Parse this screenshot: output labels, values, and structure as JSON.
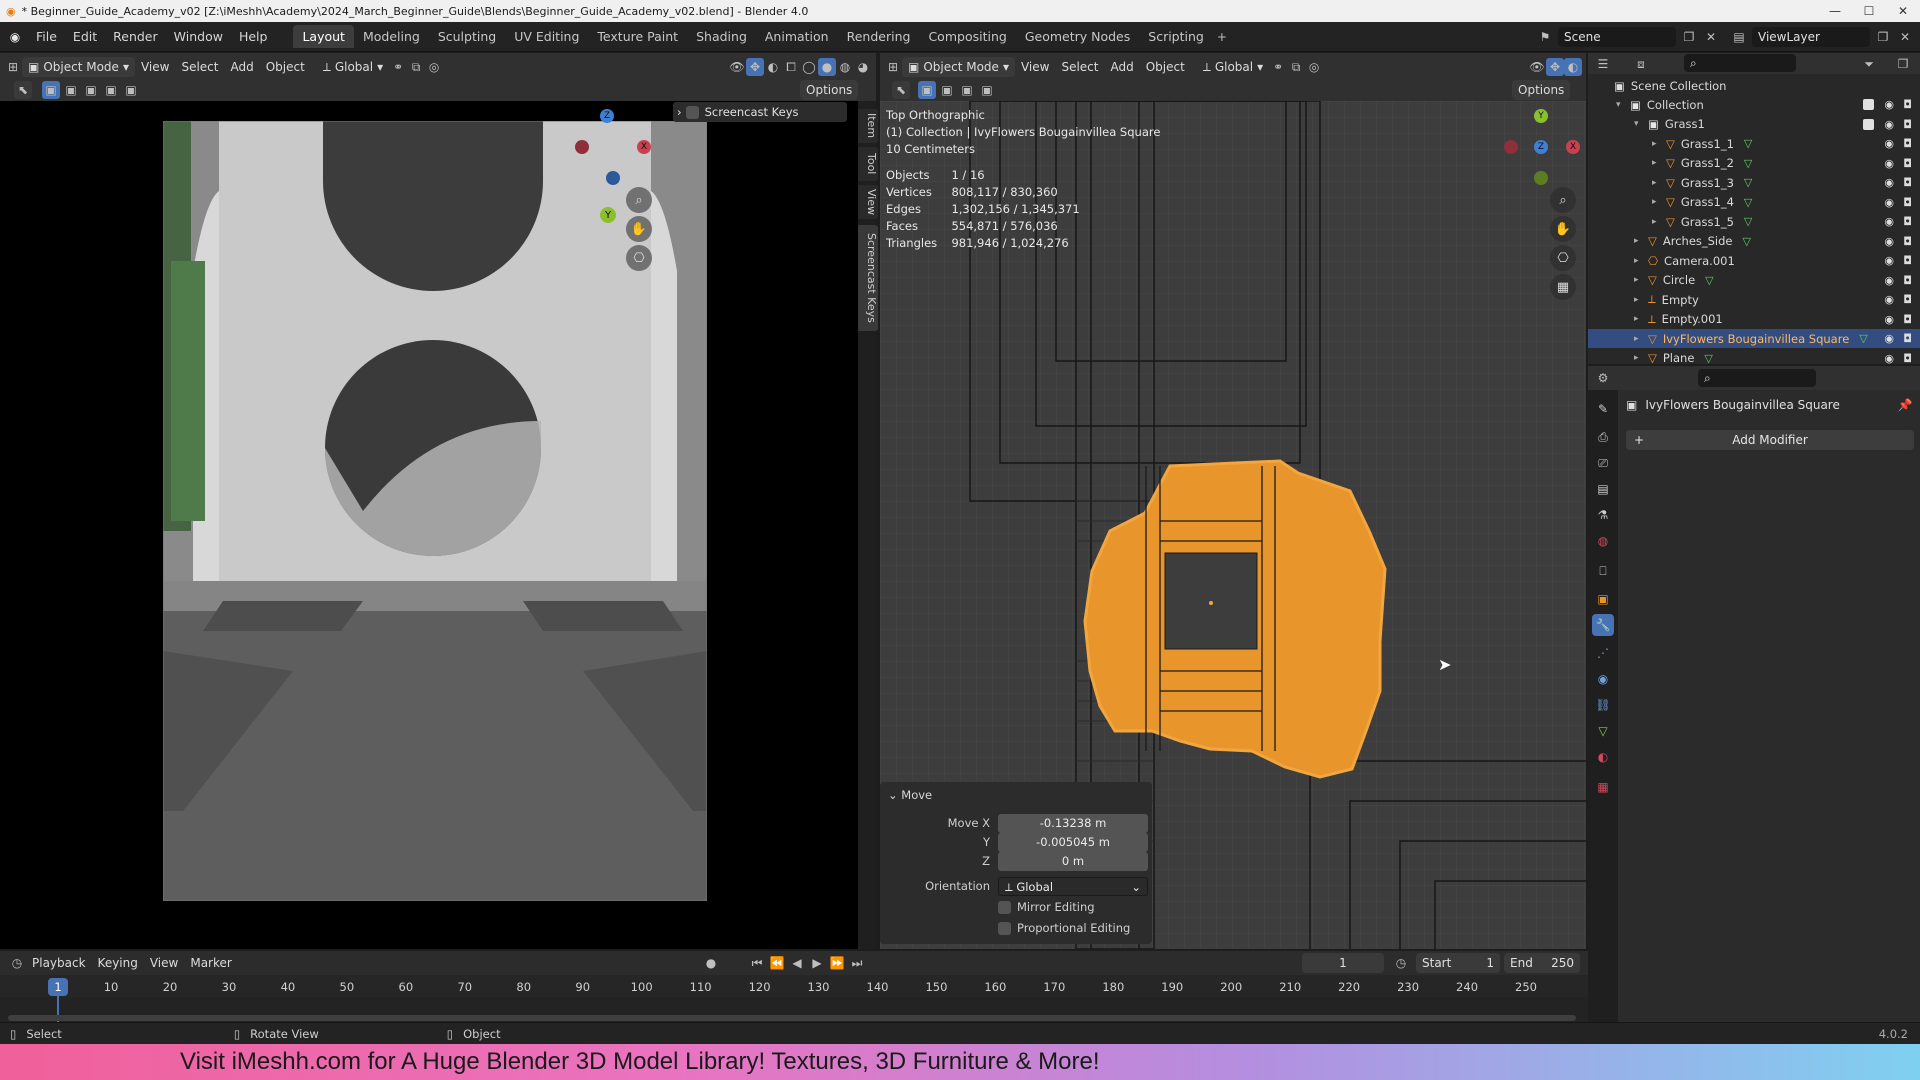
{
  "window": {
    "title": "* Beginner_Guide_Academy_v02 [Z:\\iMeshh\\Academy\\2024_March_Beginner_Guide\\Blends\\Beginner_Guide_Academy_v02.blend] - Blender 4.0"
  },
  "menus": [
    "File",
    "Edit",
    "Render",
    "Window",
    "Help"
  ],
  "workspaces": [
    "Layout",
    "Modeling",
    "Sculpting",
    "UV Editing",
    "Texture Paint",
    "Shading",
    "Animation",
    "Rendering",
    "Compositing",
    "Geometry Nodes",
    "Scripting"
  ],
  "active_workspace": "Layout",
  "scene": {
    "name": "Scene",
    "view_layer": "ViewLayer"
  },
  "left_viewport": {
    "mode": "Object Mode",
    "menus": [
      "View",
      "Select",
      "Add",
      "Object"
    ],
    "orientation": "Global",
    "options_label": "Options",
    "screencast_label": "Screencast Keys"
  },
  "sidebar_tabs": [
    "Item",
    "Tool",
    "View",
    "Screencast Keys"
  ],
  "right_viewport": {
    "mode": "Object Mode",
    "menus": [
      "View",
      "Select",
      "Add",
      "Object"
    ],
    "orientation": "Global",
    "options_label": "Options",
    "view_name": "Top Orthographic",
    "collection_line": "(1) Collection | IvyFlowers Bougainvillea Square",
    "scale": "10 Centimeters",
    "stats": [
      {
        "label": "Objects",
        "value": "1 / 16"
      },
      {
        "label": "Vertices",
        "value": "808,117 / 830,360"
      },
      {
        "label": "Edges",
        "value": "1,302,156 / 1,345,371"
      },
      {
        "label": "Faces",
        "value": "554,871 / 576,036"
      },
      {
        "label": "Triangles",
        "value": "981,946 / 1,024,276"
      }
    ]
  },
  "gizmo": {
    "x": "X",
    "y": "Y",
    "z": "Z"
  },
  "move_panel": {
    "title": "Move",
    "move_x_label": "Move X",
    "move_x": "-0.13238 m",
    "y_label": "Y",
    "y": "-0.005045 m",
    "z_label": "Z",
    "z": "0 m",
    "orientation_label": "Orientation",
    "orientation": "Global",
    "mirror": "Mirror Editing",
    "proportional": "Proportional Editing"
  },
  "outliner": {
    "root": "Scene Collection",
    "items": [
      {
        "name": "Collection",
        "level": 1
      },
      {
        "name": "Grass1",
        "level": 2
      },
      {
        "name": "Grass1_1",
        "level": 3
      },
      {
        "name": "Grass1_2",
        "level": 3
      },
      {
        "name": "Grass1_3",
        "level": 3
      },
      {
        "name": "Grass1_4",
        "level": 3
      },
      {
        "name": "Grass1_5",
        "level": 3
      },
      {
        "name": "Arches_Side",
        "level": 2
      },
      {
        "name": "Camera.001",
        "level": 2
      },
      {
        "name": "Circle",
        "level": 2
      },
      {
        "name": "Empty",
        "level": 2
      },
      {
        "name": "Empty.001",
        "level": 2
      },
      {
        "name": "IvyFlowers Bougainvillea Square",
        "level": 2,
        "selected": true
      },
      {
        "name": "Plane",
        "level": 2
      }
    ]
  },
  "properties": {
    "object_name": "IvyFlowers Bougainvillea Square",
    "add_modifier": "Add Modifier"
  },
  "timeline": {
    "menus": [
      "Playback",
      "Keying",
      "View",
      "Marker"
    ],
    "current_frame": "1",
    "start_label": "Start",
    "start": "1",
    "end_label": "End",
    "end": "250",
    "ticks": [
      "10",
      "20",
      "30",
      "40",
      "50",
      "60",
      "70",
      "80",
      "90",
      "100",
      "110",
      "120",
      "130",
      "140",
      "150",
      "160",
      "170",
      "180",
      "190",
      "200",
      "210",
      "220",
      "230",
      "240",
      "250"
    ]
  },
  "statusbar": {
    "select": "Select",
    "rotate": "Rotate View",
    "object": "Object",
    "version": "4.0.2"
  },
  "banner": "Visit iMeshh.com for A Huge Blender 3D Model Library! Textures, 3D Furniture & More!",
  "colors": {
    "accent": "#4772b3",
    "selection": "#334d80",
    "ivy": "#e8952c",
    "axis_x": "#c8414f",
    "axis_y": "#8bbf2f",
    "axis_z": "#3f7fd6"
  }
}
